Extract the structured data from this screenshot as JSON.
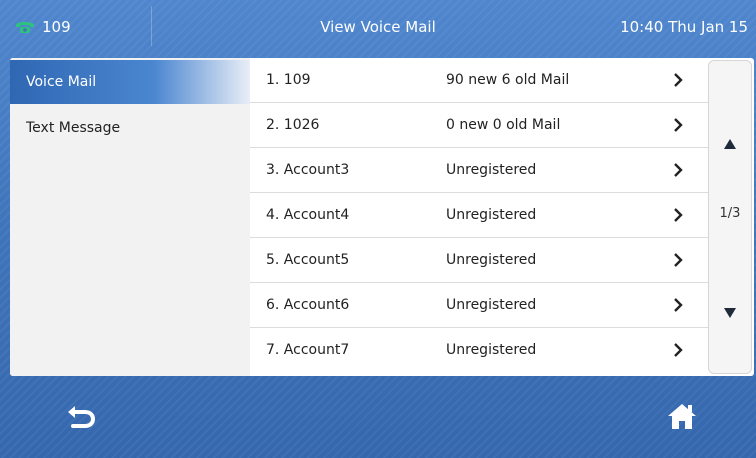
{
  "header": {
    "account": "109",
    "title": "View Voice Mail",
    "time": "10:40 Thu Jan 15",
    "phone_icon": "phone-icon",
    "phone_icon_color": "#2ec27e"
  },
  "sidebar": {
    "items": [
      {
        "label": "Voice Mail",
        "active": true
      },
      {
        "label": "Text Message",
        "active": false
      }
    ]
  },
  "list": {
    "rows": [
      {
        "number": "1. 109",
        "status": "90 new 6 old Mail"
      },
      {
        "number": "2. 1026",
        "status": "0 new 0 old Mail"
      },
      {
        "number": "3. Account3",
        "status": "Unregistered"
      },
      {
        "number": "4. Account4",
        "status": "Unregistered"
      },
      {
        "number": "5. Account5",
        "status": "Unregistered"
      },
      {
        "number": "6. Account6",
        "status": "Unregistered"
      },
      {
        "number": "7. Account7",
        "status": "Unregistered"
      }
    ]
  },
  "pager": {
    "page": "1/3"
  },
  "footer": {
    "back_icon": "back-icon",
    "home_icon": "home-icon"
  },
  "colors": {
    "accent": "#2f67b3",
    "background": "#3f74bb"
  }
}
